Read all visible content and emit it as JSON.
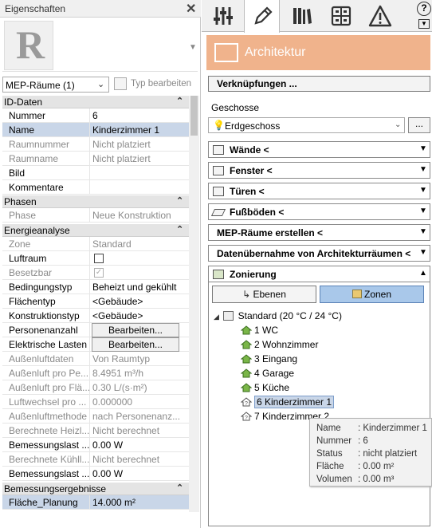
{
  "left": {
    "title": "Eigenschaften",
    "close": "✕",
    "type_selector": "MEP-Räume (1)",
    "type_edit": "Typ bearbeiten",
    "sections": [
      {
        "title": "ID-Daten",
        "rows": [
          {
            "k": "Nummer",
            "v": "6"
          },
          {
            "k": "Name",
            "v": "Kinderzimmer 1"
          },
          {
            "k": "Raumnummer",
            "v": "Nicht platziert"
          },
          {
            "k": "Raumname",
            "v": "Nicht platziert"
          },
          {
            "k": "Bild",
            "v": ""
          },
          {
            "k": "Kommentare",
            "v": ""
          }
        ]
      },
      {
        "title": "Phasen",
        "rows": [
          {
            "k": "Phase",
            "v": "Neue Konstruktion"
          }
        ]
      },
      {
        "title": "Energieanalyse",
        "rows": [
          {
            "k": "Zone",
            "v": "Standard"
          },
          {
            "k": "Luftraum",
            "v": ""
          },
          {
            "k": "Besetzbar",
            "v": ""
          },
          {
            "k": "Bedingungstyp",
            "v": "Beheizt und gekühlt"
          },
          {
            "k": "Flächentyp",
            "v": "<Gebäude>"
          },
          {
            "k": "Konstruktionstyp",
            "v": "<Gebäude>"
          },
          {
            "k": "Personenanzahl",
            "v": "Bearbeiten..."
          },
          {
            "k": "Elektrische Lasten",
            "v": "Bearbeiten..."
          },
          {
            "k": "Außenluftdaten",
            "v": "Von Raumtyp"
          },
          {
            "k": "Außenluft pro Pe...",
            "v": "8.4951 m³/h"
          },
          {
            "k": "Außenluft pro Flä...",
            "v": "0.30 L/(s·m²)"
          },
          {
            "k": "Luftwechsel pro ...",
            "v": "0.000000"
          },
          {
            "k": "Außenluftmethode",
            "v": "nach Personenanz..."
          },
          {
            "k": "Berechnete Heizl...",
            "v": "Nicht berechnet"
          },
          {
            "k": "Bemessungslast ...",
            "v": "0.00 W"
          },
          {
            "k": "Berechnete Kühll...",
            "v": "Nicht berechnet"
          },
          {
            "k": "Bemessungslast ...",
            "v": "0.00 W"
          }
        ]
      },
      {
        "title": "Bemessungsergebnisse",
        "rows": [
          {
            "k": "Fläche_Planung",
            "v": "14.000 m²"
          }
        ]
      }
    ]
  },
  "right": {
    "banner_title": "Architektur",
    "help_glyph": "?",
    "verknuepfungen": "Verknüpfungen ...",
    "geschosse_label": "Geschosse",
    "level_value": "Erdgeschoss",
    "dots": "...",
    "accordions": [
      {
        "label": "Wände <"
      },
      {
        "label": "Fenster <"
      },
      {
        "label": "Türen <"
      },
      {
        "label": "Fußböden <"
      },
      {
        "label": "MEP-Räume erstellen <"
      },
      {
        "label": "Datenübernahme von Architekturräumen <"
      },
      {
        "label": "Zonierung"
      }
    ],
    "ebenen": "Ebenen",
    "zonen": "Zonen",
    "tree_root": "Standard (20 °C / 24 °C)",
    "tree_items": [
      "1  WC",
      "2  Wohnzimmer",
      "3  Eingang",
      "4  Garage",
      "5  Küche",
      "6  Kinderzimmer 1",
      "7  Kinderzimmer 2"
    ],
    "tooltip": [
      {
        "k": "Name",
        "v": ": Kinderzimmer 1"
      },
      {
        "k": "Nummer",
        "v": ": 6"
      },
      {
        "k": "Status",
        "v": ": nicht platziert"
      },
      {
        "k": "Fläche",
        "v": ": 0.00 m²"
      },
      {
        "k": "Volumen",
        "v": ": 0.00 m³"
      }
    ]
  }
}
